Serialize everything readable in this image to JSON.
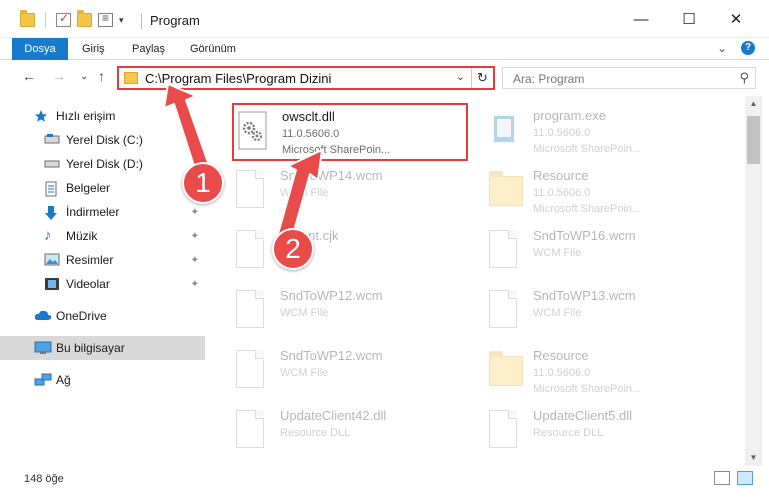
{
  "window": {
    "title": "Program",
    "minimize": "—",
    "maximize": "☐",
    "close": "✕"
  },
  "ribbon": {
    "tabs": [
      "Dosya",
      "Giriş",
      "Paylaş",
      "Görünüm"
    ],
    "collapse_glyph": "⌄",
    "help_glyph": "?"
  },
  "nav": {
    "back": "←",
    "forward": "→",
    "recent": "⌄",
    "up": "↑",
    "address": "C:\\Program Files\\Program Dizini",
    "address_dropdown": "⌄",
    "refresh": "↻",
    "search_placeholder": "Ara: Program",
    "search_glyph": "⚲"
  },
  "sidebar": {
    "items": [
      {
        "label": "Hızlı erişim",
        "icon": "star-icon"
      },
      {
        "label": "Yerel Disk (C:)",
        "icon": "drive-icon",
        "pinned": true
      },
      {
        "label": "Yerel Disk (D:)",
        "icon": "drive-icon",
        "pinned": true
      },
      {
        "label": "Belgeler",
        "icon": "documents-icon",
        "pinned": true
      },
      {
        "label": "İndirmeler",
        "icon": "download-icon",
        "pinned": true
      },
      {
        "label": "Müzik",
        "icon": "music-icon",
        "pinned": true
      },
      {
        "label": "Resimler",
        "icon": "pictures-icon",
        "pinned": true
      },
      {
        "label": "Videolar",
        "icon": "videos-icon",
        "pinned": true
      },
      {
        "label": "OneDrive",
        "icon": "cloud-icon"
      },
      {
        "label": "Bu bilgisayar",
        "icon": "computer-icon",
        "selected": true
      },
      {
        "label": "Ağ",
        "icon": "network-icon"
      }
    ],
    "pin_glyph": "📌"
  },
  "files": [
    {
      "name": "owsclt.dll",
      "line2": "11.0.5606.0",
      "line3": "Microsoft SharePoin...",
      "kind": "dll",
      "highlight": true
    },
    {
      "name": "program.exe",
      "line2": "11.0.5606.0",
      "line3": "Microsoft SharePoin...",
      "kind": "exe"
    },
    {
      "name": "SndToWP14.wcm",
      "line2": "WCM File",
      "line3": "",
      "kind": "doc"
    },
    {
      "name": "Resource",
      "line2": "11.0.5606.0",
      "line3": "Microsoft SharePoin...",
      "kind": "folder"
    },
    {
      "name": "stdfont.cjk",
      "line2": "",
      "line3": "",
      "kind": "doc"
    },
    {
      "name": "SndToWP16.wcm",
      "line2": "WCM File",
      "line3": "",
      "kind": "doc"
    },
    {
      "name": "SndToWP12.wcm",
      "line2": "WCM File",
      "line3": "",
      "kind": "doc"
    },
    {
      "name": "SndToWP13.wcm",
      "line2": "WCM File",
      "line3": "",
      "kind": "doc"
    },
    {
      "name": "SndToWP12.wcm",
      "line2": "WCM File",
      "line3": "",
      "kind": "doc"
    },
    {
      "name": "Resource",
      "line2": "11.0.5606.0",
      "line3": "Microsoft SharePoin...",
      "kind": "folder"
    },
    {
      "name": "UpdateClient42.dll",
      "line2": "Resource DLL",
      "line3": "",
      "kind": "doc"
    },
    {
      "name": "UpdateClient5.dll",
      "line2": "Resource DLL",
      "line3": "",
      "kind": "doc"
    }
  ],
  "status": {
    "count": "148 öğe"
  },
  "callouts": {
    "one": "1",
    "two": "2"
  },
  "colors": {
    "accent": "#1979ca",
    "highlight_border": "#e43b3b",
    "callout_fill": "#e94a4a"
  }
}
